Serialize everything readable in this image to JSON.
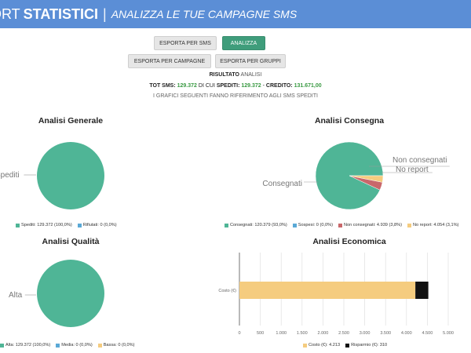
{
  "header": {
    "title_part1": "ORT",
    "title_part2": "STATISTICI",
    "separator": "|",
    "subtitle": "ANALIZZA LE TUE CAMPAGNE SMS",
    "bg_color": "#5b8ed6"
  },
  "toolbar": {
    "export_sms": "ESPORTA PER SMS",
    "analyze": "ANALIZZA",
    "export_campaigns": "ESPORTA PER CAMPAGNE",
    "export_groups": "ESPORTA PER GRUPPI"
  },
  "result": {
    "label": "RISULTATO",
    "value": "ANALISI"
  },
  "totals": {
    "tot_label": "TOT SMS:",
    "tot_value": "129.372",
    "of_which": "DI CUI",
    "sent_label": "SPEDITI:",
    "sent_value": "129.372",
    "dash": "-",
    "credit_label": "CREDITO:",
    "credit_value": "131.671,00",
    "note": "I GRAFICI SEGUENTI FANNO RIFERIMENTO AGLI SMS SPEDITI"
  },
  "colors": {
    "green": "#4fb596",
    "blue": "#5aa9d6",
    "red": "#c9686b",
    "yellow": "#f5cc7f",
    "black": "#111111"
  },
  "chart_data": [
    {
      "type": "pie",
      "title": "Analisi Generale",
      "slices": [
        {
          "name": "Spediti",
          "value": 129372,
          "legend": "Spediti: 129.372 (100,0%)",
          "color": "#4fb596",
          "show_label": true
        },
        {
          "name": "Rifiutati",
          "value": 0,
          "legend": "Rifiutati: 0 (0,0%)",
          "color": "#5aa9d6",
          "show_label": false
        }
      ]
    },
    {
      "type": "pie",
      "title": "Analisi Consegna",
      "slices": [
        {
          "name": "Consegnati",
          "value": 120379,
          "legend": "Consegnati: 120.379 (93,0%)",
          "color": "#4fb596",
          "show_label": true
        },
        {
          "name": "Sospesi",
          "value": 0,
          "legend": "Sospesi: 0 (0,0%)",
          "color": "#5aa9d6",
          "show_label": false
        },
        {
          "name": "Non consegnati",
          "value": 4939,
          "legend": "Non consegnati: 4.939 (3,8%)",
          "color": "#c9686b",
          "show_label": true
        },
        {
          "name": "No report",
          "value": 4054,
          "legend": "No report: 4.054 (3,1%)",
          "color": "#f5cc7f",
          "show_label": true
        }
      ]
    },
    {
      "type": "pie",
      "title": "Analisi Qualità",
      "slices": [
        {
          "name": "Alta",
          "value": 129372,
          "legend": "Alta: 129.372 (100,0%)",
          "color": "#4fb596",
          "show_label": true
        },
        {
          "name": "Media",
          "value": 0,
          "legend": "Media: 0 (0,0%)",
          "color": "#5aa9d6",
          "show_label": false
        },
        {
          "name": "Bassa",
          "value": 0,
          "legend": "Bassa: 0 (0,0%)",
          "color": "#f5cc7f",
          "show_label": false
        }
      ]
    },
    {
      "type": "bar",
      "orientation": "horizontal",
      "stacked": true,
      "title": "Analisi Economica",
      "categories": [
        "Costo (€)"
      ],
      "series": [
        {
          "name": "Costo (€)",
          "values": [
            4213
          ],
          "legend": "Costo (€): 4.213",
          "color": "#f5cc7f"
        },
        {
          "name": "Risparmio (€)",
          "values": [
            310
          ],
          "legend": "Risparmio (€): 310",
          "color": "#111111"
        }
      ],
      "xlim": [
        0,
        5000
      ],
      "xticks": [
        0,
        500,
        1000,
        1500,
        2000,
        2500,
        3000,
        3500,
        4000,
        4500,
        5000
      ],
      "xtick_labels": [
        "0",
        "500",
        "1.000",
        "1.500",
        "2.000",
        "2.500",
        "3.000",
        "3.500",
        "4.000",
        "4.500",
        "5.000"
      ],
      "grid": true
    }
  ]
}
